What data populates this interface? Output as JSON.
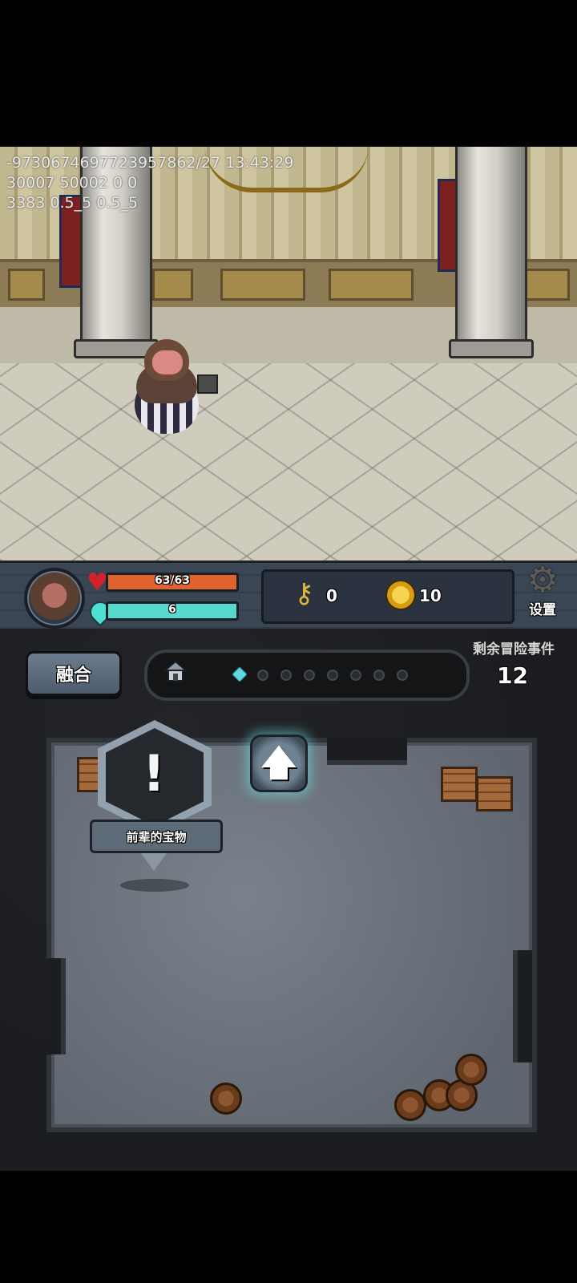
{
  "debug_overlay": {
    "line1": "-9730674697723957862/27 13:43:29",
    "line2": "30007 50002 0 0",
    "line3": "3383 0.5_5 0.5_5"
  },
  "hud": {
    "hp": {
      "text": "63/63",
      "current": 63,
      "max": 63,
      "color": "#e0622d"
    },
    "mp": {
      "text": "6",
      "fraction": 1.0,
      "color": "#56d9cf"
    },
    "keys": {
      "count": "0",
      "icon": "key-icon"
    },
    "coins": {
      "count": "10",
      "icon": "coin-icon"
    },
    "settings_label": "设置"
  },
  "panel": {
    "merge_label": "融合",
    "remaining_label": "剩余冒险事件",
    "remaining_count": "12",
    "progress": {
      "total_steps": 8,
      "current_step": 1
    }
  },
  "map": {
    "event": {
      "label": "前辈的宝物",
      "icon": "exclamation-icon"
    },
    "move_button_icon": "arrow-up-icon"
  }
}
